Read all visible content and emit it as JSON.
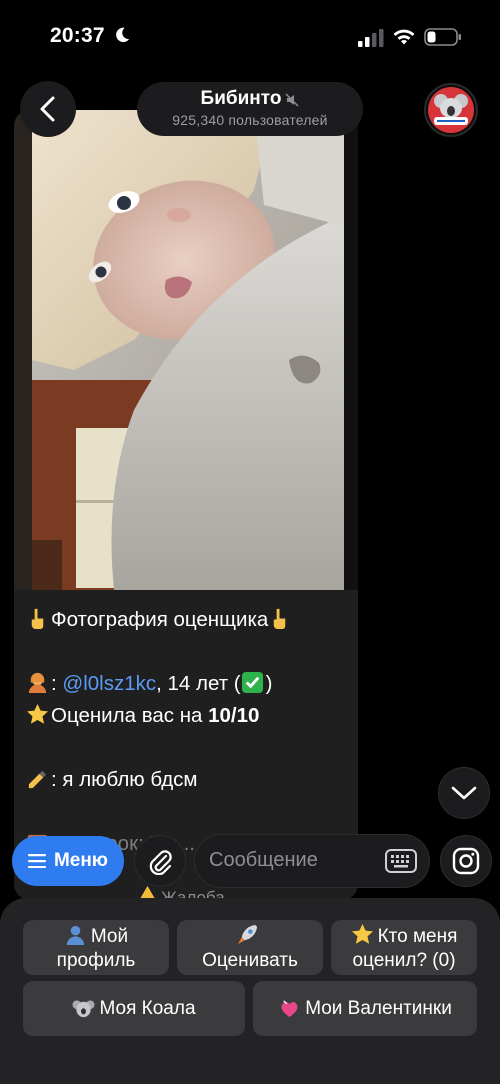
{
  "status_bar": {
    "time": "20:37"
  },
  "header": {
    "title": "Бибинто",
    "subtitle": "925,340 пользователей"
  },
  "message": {
    "heading": "Фотография оценщика",
    "mention": "@l0lsz1kc",
    "age": ", 14 лет (",
    "age_close": ")",
    "rated_prefix": "Оценила вас на ",
    "rated_value": "10/10",
    "quote": ": я люблю бдсм",
    "truncated_line": "Надо рок: Mo..."
  },
  "complaint": "Жалоба",
  "input": {
    "menu_label": "Меню",
    "placeholder": "Сообщение"
  },
  "keyboard": {
    "my_profile": "Мой профиль",
    "rate": "Оценивать",
    "who_rated": "Кто меня оценил? (0)",
    "my_koala": "Моя Коала",
    "my_valentines": "Мои Валентинки"
  },
  "colors": {
    "accent": "#2f7bf0",
    "mention": "#5b9bf5",
    "panel": "#232325",
    "button": "#3b3b3d"
  }
}
